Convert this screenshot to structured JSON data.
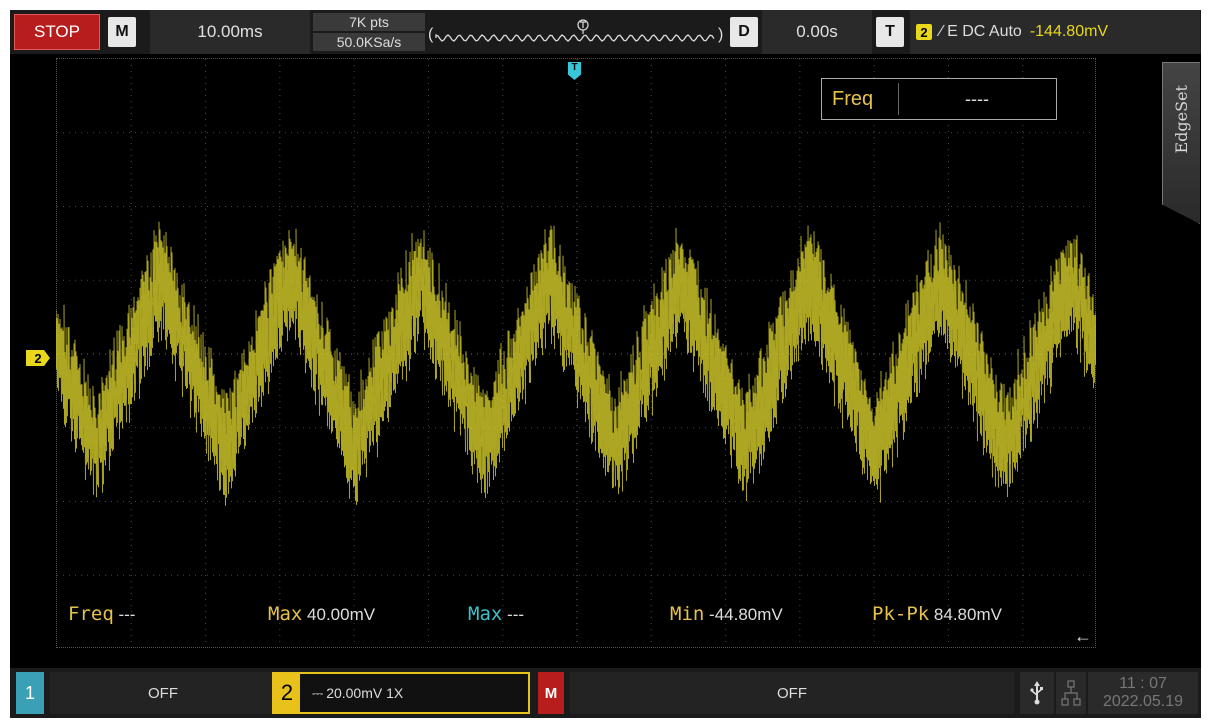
{
  "topbar": {
    "run_state": "STOP",
    "mode_key": "M",
    "timebase": "10.00ms",
    "memory_depth": "7K pts",
    "sample_rate": "50.0KSa/s",
    "delay_key": "D",
    "delay": "0.00s",
    "trigger_key": "T",
    "trigger_channel": "2",
    "trigger_settings": "∕ E DC Auto",
    "trigger_level": "-144.80mV"
  },
  "markers": {
    "channel2": "2",
    "trigger": "T"
  },
  "freq_box": {
    "label": "Freq",
    "value": "----"
  },
  "side_menu": {
    "tab_label": "EdgeSet"
  },
  "measurements": {
    "freq": {
      "label": "Freq",
      "value": " ---"
    },
    "max": {
      "label": "Max",
      "value": " 40.00mV"
    },
    "max_ch1": {
      "label": "Max",
      "value": " ---"
    },
    "min": {
      "label": "Min",
      "value": " -44.80mV"
    },
    "pkpk": {
      "label": "Pk-Pk",
      "value": " 84.80mV"
    }
  },
  "bottombar": {
    "ch1_key": "1",
    "ch1_status": "OFF",
    "ch2_key": "2",
    "ch2_coupling": "⎓",
    "ch2_setting": "20.00mV 1X",
    "math_key": "M",
    "math_status": "OFF",
    "clock_time": "11 : 07",
    "clock_date": "2022.05.19"
  },
  "icons": {
    "usb": "usb-icon",
    "network": "network-icon",
    "back_arrow": "arrow-left-icon"
  },
  "waveform": {
    "color": "#d8cf2a",
    "cycles": 8,
    "shape": "noisy triangle",
    "pk_pk_mV": 84.8,
    "max_mV": 40.0,
    "min_mV": -44.8,
    "volts_per_div_mV": 20.0,
    "time_per_div_ms": 10.0
  }
}
